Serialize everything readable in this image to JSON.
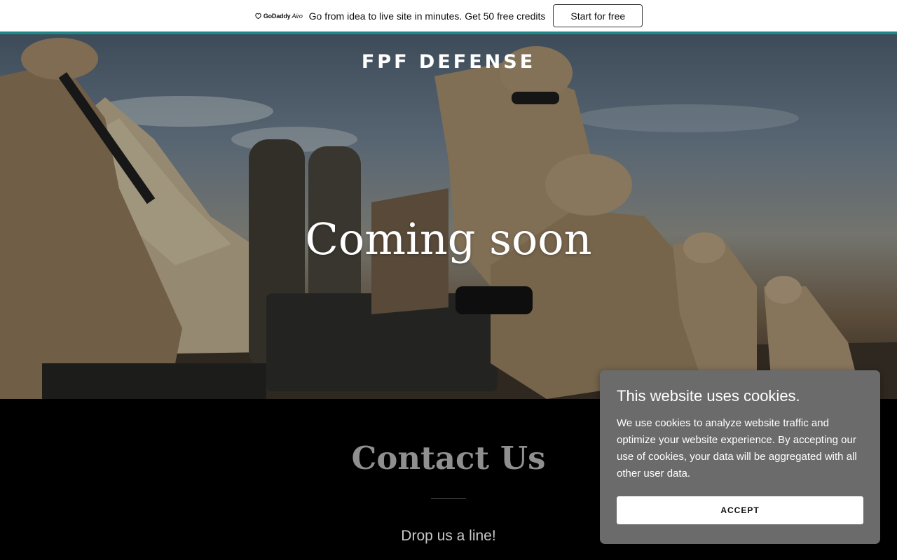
{
  "promo": {
    "logo_text": "GoDaddy",
    "logo_suffix": "Airo",
    "message": "Go from idea to live site in minutes. Get 50 free credits",
    "cta_label": "Start for free"
  },
  "hero": {
    "site_title": "FPF DEFENSE",
    "heading": "Coming soon"
  },
  "contact": {
    "title": "Contact Us",
    "subtitle": "Drop us a line!"
  },
  "cookie_banner": {
    "title": "This website uses cookies.",
    "body": "We use cookies to analyze website traffic and optimize your website experience. By accepting our use of cookies, your data will be aggregated with all other user data.",
    "accept_label": "ACCEPT"
  },
  "colors": {
    "accent": "#1d8a8a",
    "cookie_panel": "#6b6b6b",
    "contact_background": "#000000"
  }
}
